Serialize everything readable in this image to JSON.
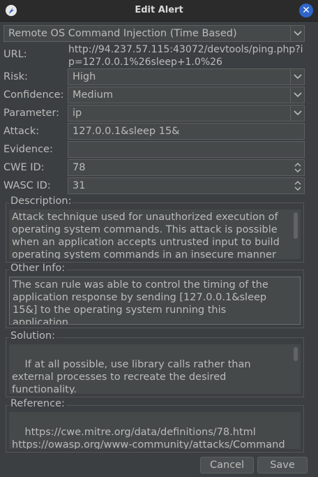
{
  "window": {
    "title": "Edit Alert",
    "close_icon": "close-icon"
  },
  "alert": {
    "name": "Remote OS Command Injection (Time Based)",
    "url_label": "URL:",
    "url": "http://94.237.57.115:43072/devtools/ping.php?ip=127.0.0.1%26sleep+1.0%26",
    "risk_label": "Risk:",
    "risk": "High",
    "confidence_label": "Confidence:",
    "confidence": "Medium",
    "parameter_label": "Parameter:",
    "parameter": "ip",
    "attack_label": "Attack:",
    "attack": "127.0.0.1&sleep 15&",
    "evidence_label": "Evidence:",
    "evidence": "",
    "cwe_label": "CWE ID:",
    "cwe": "78",
    "wasc_label": "WASC ID:",
    "wasc": "31"
  },
  "description": {
    "title": "Description:",
    "text": "Attack technique used for unauthorized execution of operating system commands. This attack is possible when an application accepts untrusted input to build operating system commands in an insecure manner"
  },
  "other_info": {
    "title": "Other Info:",
    "text": "The scan rule was able to control the timing of the application response by sending [127.0.0.1&sleep 15&] to the operating system running this application."
  },
  "solution": {
    "title": "Solution:",
    "text": "If at all possible, use library calls rather than external processes to recreate the desired functionality.\n\nRun your code in a \"jail\" or similar sandbox"
  },
  "reference": {
    "title": "Reference:",
    "text": "https://cwe.mitre.org/data/definitions/78.html\nhttps://owasp.org/www-community/attacks/Command_Injection"
  },
  "buttons": {
    "cancel": "Cancel",
    "save": "Save"
  },
  "colors": {
    "accent": "#2f65ca",
    "background": "#3c3f41",
    "field": "#45494a"
  }
}
